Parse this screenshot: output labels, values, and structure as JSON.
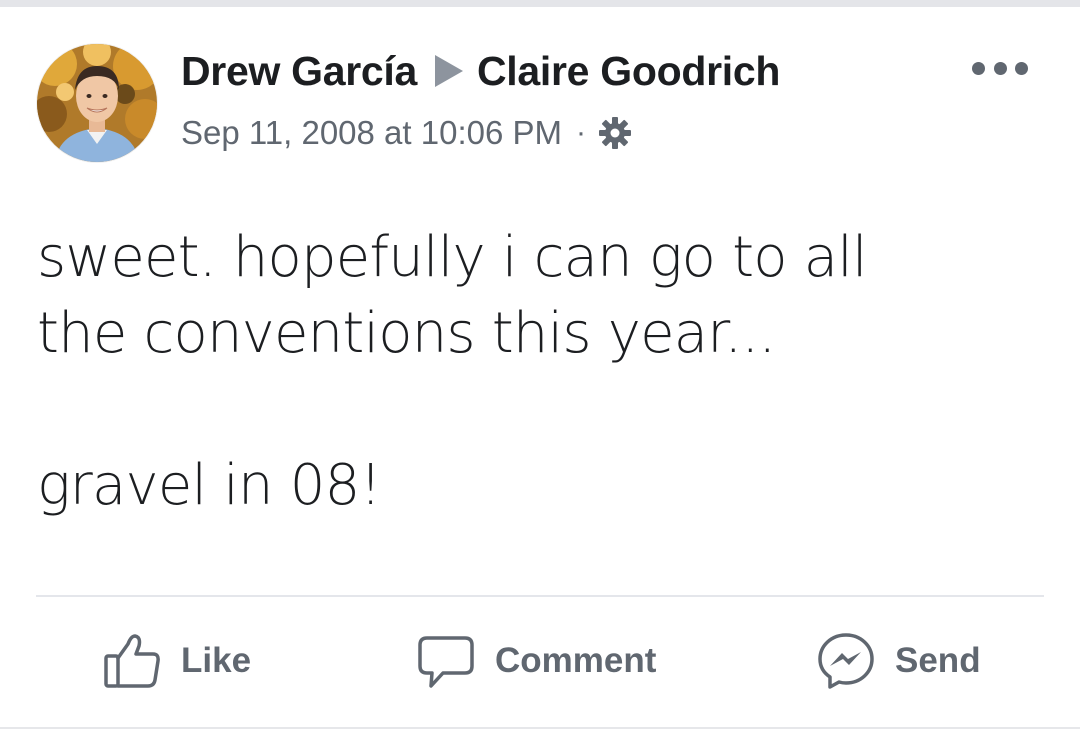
{
  "post": {
    "author": "Drew García",
    "recipient": "Claire Goodrich",
    "timestamp": "Sep 11, 2008 at 10:06 PM",
    "separator": "·",
    "privacy_icon": "gear-icon",
    "body_lines": [
      "sweet. hopefully i can go to all",
      "the conventions this year..."
    ],
    "body_last": "gravel in 08!"
  },
  "actions": {
    "like_label": "Like",
    "comment_label": "Comment",
    "send_label": "Send"
  },
  "icons": {
    "arrow": "arrow-right-icon",
    "more": "more-options-icon",
    "like": "thumbs-up-icon",
    "comment": "comment-bubble-icon",
    "send": "messenger-icon"
  },
  "colors": {
    "text_primary": "#1c1e21",
    "text_secondary": "#606770",
    "arrow": "#8d949e",
    "divider": "#e4e6eb"
  }
}
